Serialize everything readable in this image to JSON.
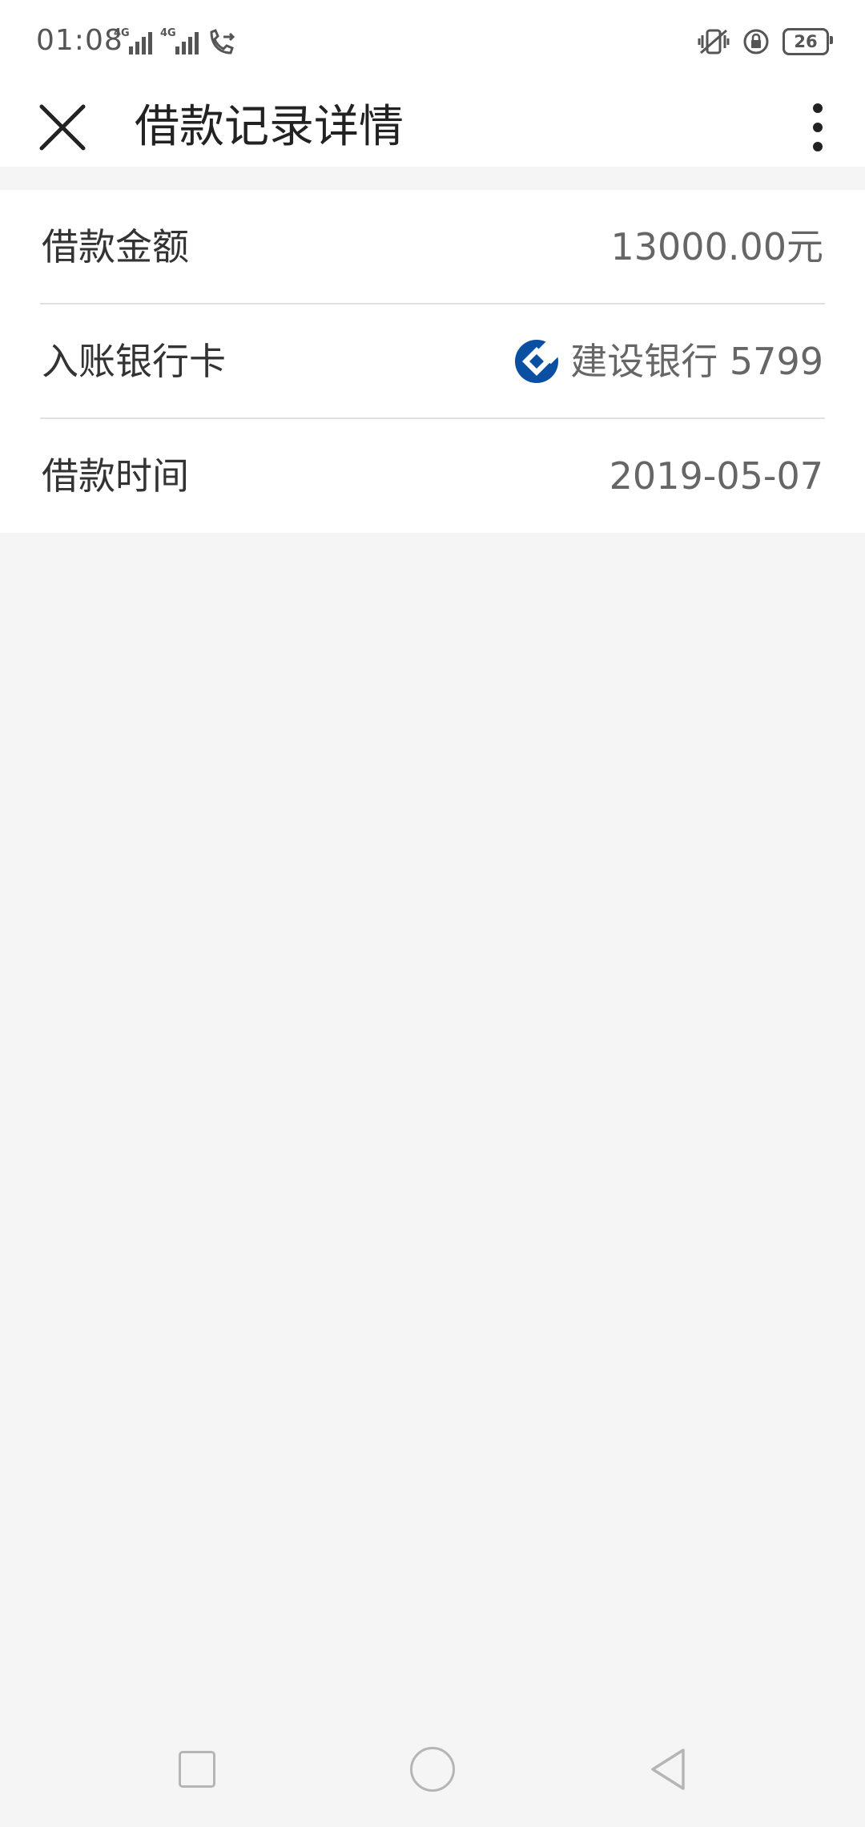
{
  "status_bar": {
    "time": "01:08",
    "network_1": "4G",
    "network_2": "4G",
    "battery": "26",
    "icons": [
      "signal-icon",
      "call-forward-icon",
      "vibrate-icon",
      "rotation-lock-icon",
      "battery-icon"
    ]
  },
  "header": {
    "title": "借款记录详情",
    "close_icon": "close-icon",
    "more_icon": "more-vert-icon"
  },
  "details": {
    "amount_label": "借款金额",
    "amount_value": "13000.00元",
    "bank_label": "入账银行卡",
    "bank_value": "建设银行 5799",
    "bank_icon": "ccb-logo-icon",
    "time_label": "借款时间",
    "time_value": "2019-05-07"
  },
  "colors": {
    "accent": "#0a4fa1",
    "card_bg": "#ffffff",
    "page_bg": "#f5f5f5",
    "divider": "#e0e0e0"
  },
  "nav_bar": {
    "icons": [
      "recent-apps-icon",
      "home-icon",
      "back-icon"
    ]
  }
}
